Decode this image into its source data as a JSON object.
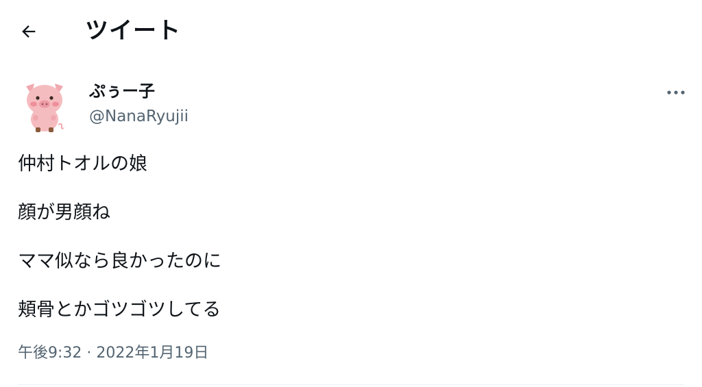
{
  "header": {
    "title": "ツイート"
  },
  "tweet": {
    "author": {
      "display_name": "ぷぅー子",
      "handle": "@NanaRyujii"
    },
    "lines": [
      "仲村トオルの娘",
      "顔が男顔ね",
      "ママ似なら良かったのに",
      "頬骨とかゴツゴツしてる"
    ],
    "timestamp": "午後9:32 · 2022年1月19日"
  },
  "icons": {
    "back": "arrow-left-icon",
    "more": "more-horizontal-icon",
    "avatar": "pig-avatar"
  },
  "colors": {
    "text_primary": "#0f1419",
    "text_secondary": "#536471",
    "divider": "#eff3f4",
    "avatar_pink": "#f3b4b8"
  }
}
